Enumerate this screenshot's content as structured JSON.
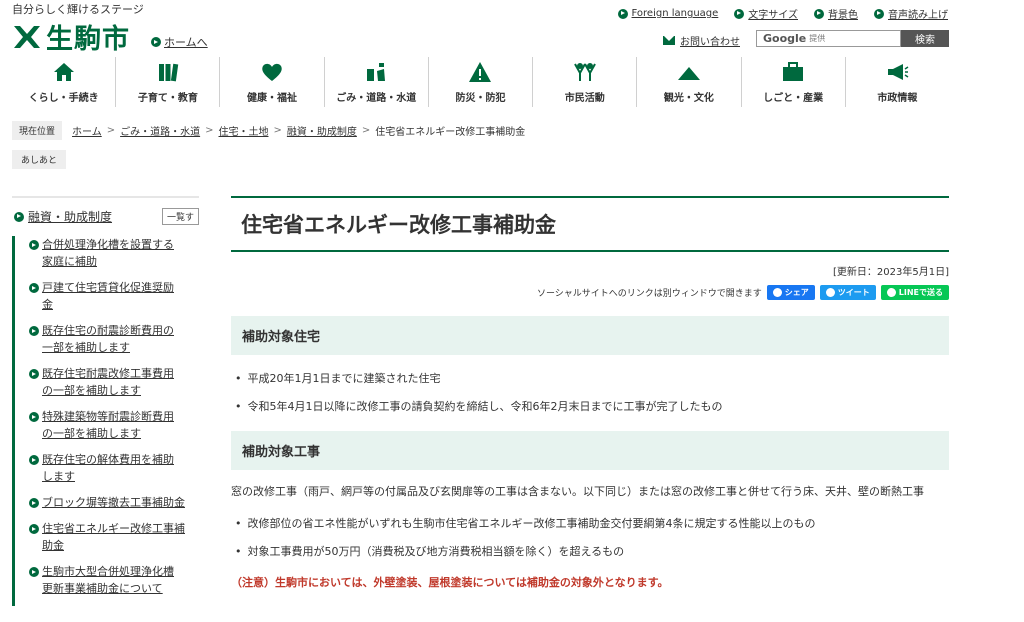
{
  "header": {
    "tagline": "自分らしく輝けるステージ",
    "logo_text": "生駒市",
    "home_link": "ホームへ",
    "utility_links": [
      "Foreign language",
      "文字サイズ",
      "背景色",
      "音声読み上げ"
    ],
    "contact": "お問い合わせ",
    "search": {
      "brand": "Google",
      "brand_sub": "提供",
      "button": "検索"
    }
  },
  "global_nav": [
    {
      "label": "くらし・手続き",
      "icon": "house-icon"
    },
    {
      "label": "子育て・教育",
      "icon": "books-icon"
    },
    {
      "label": "健康・福祉",
      "icon": "heart-icon"
    },
    {
      "label": "ごみ・道路・水道",
      "icon": "recycle-icon"
    },
    {
      "label": "防災・防犯",
      "icon": "warning-icon"
    },
    {
      "label": "市民活動",
      "icon": "people-icon"
    },
    {
      "label": "観光・文化",
      "icon": "mountain-icon"
    },
    {
      "label": "しごと・産業",
      "icon": "briefcase-icon"
    },
    {
      "label": "市政情報",
      "icon": "megaphone-icon"
    }
  ],
  "breadcrumb": {
    "label": "現在位置",
    "items": [
      "ホーム",
      "ごみ・道路・水道",
      "住宅・土地",
      "融資・助成制度",
      "住宅省エネルギー改修工事補助金"
    ]
  },
  "footprint": "あしあと",
  "sidebar": {
    "heading": "融資・助成制度",
    "hide_button": "一覧す",
    "items": [
      [
        "合併処理浄化槽を設置する",
        "家庭に補助"
      ],
      [
        "戸建て住宅賃貸化促進奨励",
        "金"
      ],
      [
        "既存住宅の耐震診断費用の",
        "一部を補助します"
      ],
      [
        "既存住宅耐震改修工事費用",
        "の一部を補助します"
      ],
      [
        "特殊建築物等耐震診断費用",
        "の一部を補助します"
      ],
      [
        "既存住宅の解体費用を補助",
        "します"
      ],
      [
        "ブロック塀等撤去工事補助金"
      ],
      [
        "住宅省エネルギー改修工事補",
        "助金"
      ],
      [
        "生駒市大型合併処理浄化槽",
        "更新事業補助金について"
      ]
    ]
  },
  "main": {
    "title": "住宅省エネルギー改修工事補助金",
    "updated": "[更新日：2023年5月1日]",
    "social_note": "ソーシャルサイトへのリンクは別ウィンドウで開きます",
    "social_buttons": [
      "シェア",
      "ツイート",
      "LINEで送る"
    ],
    "section1": {
      "heading": "補助対象住宅",
      "items": [
        "平成20年1月1日までに建築された住宅",
        "令和5年4月1日以降に改修工事の請負契約を締結し、令和6年2月末日までに工事が完了したもの"
      ]
    },
    "section2": {
      "heading": "補助対象工事",
      "paragraph": "窓の改修工事（雨戸、網戸等の付属品及び玄関扉等の工事は含まない。以下同じ）または窓の改修工事と併せて行う床、天井、壁の断熱工事",
      "items": [
        "改修部位の省エネ性能がいずれも生駒市住宅省エネルギー改修工事補助金交付要綱第4条に規定する性能以上のもの",
        "対象工事費用が50万円（消費税及び地方消費税相当額を除く）を超えるもの"
      ],
      "caution": "（注意）生駒市においては、外壁塗装、屋根塗装については補助金の対象外となります。"
    }
  },
  "colors": {
    "brand_green": "#00693e",
    "section_bg": "#e7f3ef",
    "caution_red": "#c0392b"
  }
}
